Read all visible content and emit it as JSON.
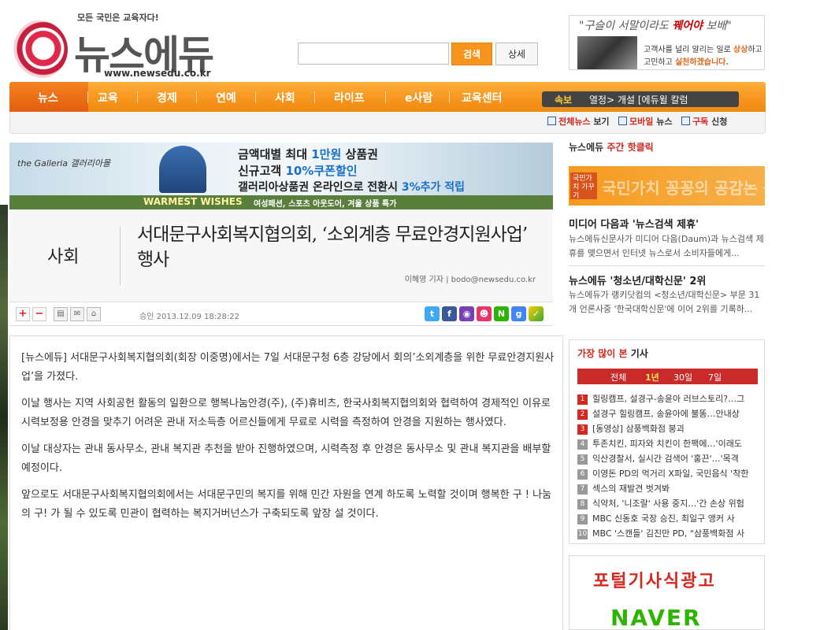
{
  "header": {
    "tagline": "모든 국민은 교육자다!",
    "logo_text": "뉴스에듀",
    "logo_url": "www.newsedu.co.kr",
    "search_button": "검색",
    "detail_button": "상세",
    "search_placeholder": ""
  },
  "top_ad": {
    "hand_pre": "\"구슬이 서말이라도 ",
    "hand_hl": "꿰어야",
    "hand_post": " 보배\"",
    "line1_pre": "고객사를 널리 알리는 일로 ",
    "line1_hl": "상상",
    "line1_post": "하고",
    "line2_pre": "고민하고 ",
    "line2_hl": "실천하겠습니다."
  },
  "nav": {
    "items": [
      "뉴스",
      "교육",
      "경제",
      "연예",
      "사회",
      "라이프",
      "e사람",
      "교육센터"
    ],
    "breaking_label": "속보",
    "breaking_text": "열정> 개설   [에듀윌 칼럼"
  },
  "subnav": {
    "items": [
      {
        "hl": "전체뉴스",
        "rest": " 보기"
      },
      {
        "hl": "모바일",
        "rest": " 뉴스"
      },
      {
        "hl": "구독",
        "rest": " 신청"
      }
    ]
  },
  "banner": {
    "brand": "the Galleria 갤러리아몰",
    "line1_pre": "금액대별 최대 ",
    "line1_hl": "1만원",
    "line1_post": " 상품권",
    "line2_pre": "신규고객 ",
    "line2_hl": "10%쿠폰할인",
    "line3_pre": "갤러리아상품권 온라인으로 전환시 ",
    "line3_hl": "3%추가 적립",
    "strip_title": "WARMEST WISHES",
    "strip_text": "여성패션, 스포츠 아웃도어,  겨울 상품 특가"
  },
  "article": {
    "section": "사회",
    "title": "서대문구사회복지협의회, ‘소외계층 무료안경지원사업’ 행사",
    "byline": "이혜영 기자  |  bodo@newsedu.co.kr",
    "approved": "승인 2013.12.09  18:28:22",
    "font_plus": "+",
    "font_minus": "−",
    "paragraphs": [
      "[뉴스에듀] 서대문구사회복지협의회(회장 이중명)에서는 7일 서대문구청 6층 강당에서 회의’소외계층을 위한 무료안경지원사업’을 가졌다.",
      "이날 행사는 지역 사회공헌 활동의 일환으로 행복나눔안경(주), (주)휴비츠, 한국사회복지협의회와 협력하여 경제적인 이유로 시력보정용 안경을 맞추기 어려운 관내 저소득층 어르신들에게 무료로 시력을 측정하여 안경을 지원하는 행사였다.",
      "이날 대상자는 관내 동사무소, 관내 복지관 추천을 받아 진행하였으며, 시력측정 후 안경은 동사무소 및 관내 복지관을 배부할 예정이다.",
      "앞으로도 서대문구사회복지협의회에서는 서대문구민의 복지를 위해 민간 자원을 연계 하도록 노력할 것이며 행복한 구 ! 나눔의 구! 가 될 수 있도록 민관이 협력하는 복지거버넌스가 구축되도록 앞장 설 것이다."
    ]
  },
  "right": {
    "hot_click_pre": "뉴스에듀 ",
    "hot_click_hl": "주간 핫클릭",
    "ad_tag": "국민가치 가꾸기",
    "ad_text": "국민가치 꽁꽁의 공감논 콩",
    "news": [
      {
        "title": "미디어 다음과 '뉴스검색 제휴'",
        "desc": "뉴스에듀신문사가 미디어 다음(Daum)과 뉴스검색 제휴를 맺으면서 인터넷 뉴스로서 소비자들에게..."
      },
      {
        "title": "뉴스에듀 '청소년/대학신문' 2위",
        "desc": "뉴스에듀가 랭키닷컴의 <청소년/대학신문> 부문 31개 언론사중 '한국대학신문'에 이어 2위를 기록하..."
      }
    ],
    "most_viewed_hl": "가장 많이 본",
    "most_viewed_rest": " 기사",
    "tabs": [
      "전체",
      "1년",
      "30일",
      "7일"
    ],
    "active_tab": "1년",
    "list": [
      {
        "n": "1",
        "t": "힐링캠프, 설경구-송윤아 러브스토리?…그"
      },
      {
        "n": "2",
        "t": "설경구 힐링캠프, 송윤아에 불똥…안내상"
      },
      {
        "n": "3",
        "t": "[동영상] 삼풍백화점 붕괴"
      },
      {
        "n": "4",
        "t": "투존치킨, 피자와 치킨이 한팩에…'이래도"
      },
      {
        "n": "5",
        "t": "익산경찰서, 실시간 검색어 '홍끈'…'목격"
      },
      {
        "n": "6",
        "t": "이영돈 PD의 먹거리 X파일, 국민음식 '착한"
      },
      {
        "n": "7",
        "t": "섹스의 재발견 벗겨봐"
      },
      {
        "n": "8",
        "t": "식약처, '니조랄' 사용 중지…'간 손상 위험"
      },
      {
        "n": "9",
        "t": "MBC 신동호 국장 승진, 최일구 앵커 사"
      },
      {
        "n": "10",
        "t": "MBC '스캔들' 김진만 PD, \"삼풍백화점 사"
      }
    ],
    "portal_title": "포털기사식광고",
    "portal_brand": "NAVER"
  }
}
